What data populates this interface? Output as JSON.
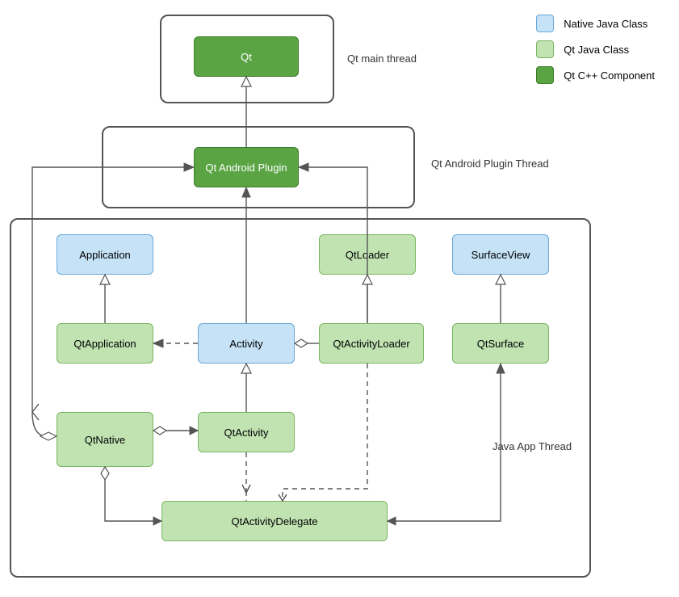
{
  "legend": {
    "native": "Native Java Class",
    "qtjava": "Qt Java Class",
    "qtcpp": "Qt C++ Component"
  },
  "labels": {
    "qt_main_thread": "Qt main thread",
    "qt_android_plugin_thread": "Qt Android Plugin Thread",
    "java_app_thread": "Java App Thread"
  },
  "nodes": {
    "qt": "Qt",
    "qt_android_plugin": "Qt Android Plugin",
    "application": "Application",
    "qtloader": "QtLoader",
    "surfaceview": "SurfaceView",
    "qtapplication": "QtApplication",
    "activity": "Activity",
    "qtactivityloader": "QtActivityLoader",
    "qtsurface": "QtSurface",
    "qtnative": "QtNative",
    "qtactivity": "QtActivity",
    "qtactivitydelegate": "QtActivityDelegate"
  },
  "chart_data": {
    "type": "diagram",
    "title": "Qt Android architecture",
    "legend": [
      {
        "key": "native-java",
        "label": "Native Java Class",
        "color": "#c5e2f6"
      },
      {
        "key": "qt-java",
        "label": "Qt Java Class",
        "color": "#c0e3b1"
      },
      {
        "key": "qt-cpp",
        "label": "Qt C++ Component",
        "color": "#5aa444"
      }
    ],
    "containers": [
      {
        "id": "qt-main-thread",
        "label": "Qt main thread"
      },
      {
        "id": "qt-android-plugin-thread",
        "label": "Qt Android Plugin Thread"
      },
      {
        "id": "java-app-thread",
        "label": "Java App Thread"
      }
    ],
    "nodes": [
      {
        "id": "qt",
        "label": "Qt",
        "class": "qt-cpp",
        "container": "qt-main-thread"
      },
      {
        "id": "qt_android_plugin",
        "label": "Qt Android Plugin",
        "class": "qt-cpp",
        "container": "qt-android-plugin-thread"
      },
      {
        "id": "application",
        "label": "Application",
        "class": "native-java",
        "container": "java-app-thread"
      },
      {
        "id": "qtloader",
        "label": "QtLoader",
        "class": "qt-java",
        "container": "java-app-thread"
      },
      {
        "id": "surfaceview",
        "label": "SurfaceView",
        "class": "native-java",
        "container": "java-app-thread"
      },
      {
        "id": "qtapplication",
        "label": "QtApplication",
        "class": "qt-java",
        "container": "java-app-thread"
      },
      {
        "id": "activity",
        "label": "Activity",
        "class": "native-java",
        "container": "java-app-thread"
      },
      {
        "id": "qtactivityloader",
        "label": "QtActivityLoader",
        "class": "qt-java",
        "container": "java-app-thread"
      },
      {
        "id": "qtsurface",
        "label": "QtSurface",
        "class": "qt-java",
        "container": "java-app-thread"
      },
      {
        "id": "qtnative",
        "label": "QtNative",
        "class": "qt-java",
        "container": "java-app-thread"
      },
      {
        "id": "qtactivity",
        "label": "QtActivity",
        "class": "qt-java",
        "container": "java-app-thread"
      },
      {
        "id": "qtactivitydelegate",
        "label": "QtActivityDelegate",
        "class": "qt-java",
        "container": "java-app-thread"
      }
    ],
    "edges": [
      {
        "from": "qt_android_plugin",
        "to": "qt",
        "type": "generalization",
        "style": "solid"
      },
      {
        "from": "qtnative",
        "to": "qt_android_plugin",
        "type": "association",
        "style": "solid",
        "bidirectional": true
      },
      {
        "from": "activity",
        "to": "qt_android_plugin",
        "type": "association",
        "style": "solid"
      },
      {
        "from": "qtactivityloader",
        "to": "qt_android_plugin",
        "type": "association",
        "style": "solid"
      },
      {
        "from": "qtapplication",
        "to": "application",
        "type": "generalization",
        "style": "solid"
      },
      {
        "from": "qtactivityloader",
        "to": "qtloader",
        "type": "generalization",
        "style": "solid"
      },
      {
        "from": "qtsurface",
        "to": "surfaceview",
        "type": "generalization",
        "style": "solid"
      },
      {
        "from": "qtactivity",
        "to": "activity",
        "type": "generalization",
        "style": "solid"
      },
      {
        "from": "activity",
        "to": "qtapplication",
        "type": "dependency",
        "style": "dashed"
      },
      {
        "from": "activity",
        "to": "qtactivityloader",
        "type": "aggregation",
        "style": "solid"
      },
      {
        "from": "qtnative",
        "to": "qtactivity",
        "type": "aggregation",
        "style": "solid"
      },
      {
        "from": "qtnative",
        "to": "qtactivitydelegate",
        "type": "aggregation",
        "style": "solid"
      },
      {
        "from": "qtactivity",
        "to": "qtactivitydelegate",
        "type": "dependency",
        "style": "dashed"
      },
      {
        "from": "qtactivityloader",
        "to": "qtactivitydelegate",
        "type": "dependency",
        "style": "dashed"
      },
      {
        "from": "qtactivitydelegate",
        "to": "qtsurface",
        "type": "association",
        "style": "solid"
      }
    ]
  }
}
